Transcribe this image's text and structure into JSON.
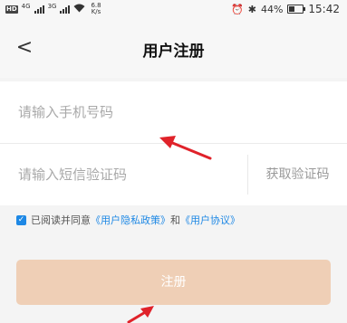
{
  "status_bar": {
    "hd_label": "HD",
    "net_a": "4G",
    "net_b": "3G",
    "speed_value": "6.8",
    "speed_unit": "K/s",
    "battery": "44%",
    "time": "15:42"
  },
  "nav": {
    "back_glyph": "<",
    "title": "用户注册"
  },
  "form": {
    "phone_placeholder": "请输入手机号码",
    "code_placeholder": "请输入短信验证码",
    "get_code_label": "获取验证码"
  },
  "agreement": {
    "checked": true,
    "prefix": "已阅读并同意",
    "privacy_link": "《用户隐私政策》",
    "joiner": "和",
    "terms_link": "《用户协议》"
  },
  "register_button": {
    "label": "注册"
  },
  "colors": {
    "accent": "#1e88e5",
    "button_bg": "#efcfb6",
    "annotation": "#e0222a"
  }
}
